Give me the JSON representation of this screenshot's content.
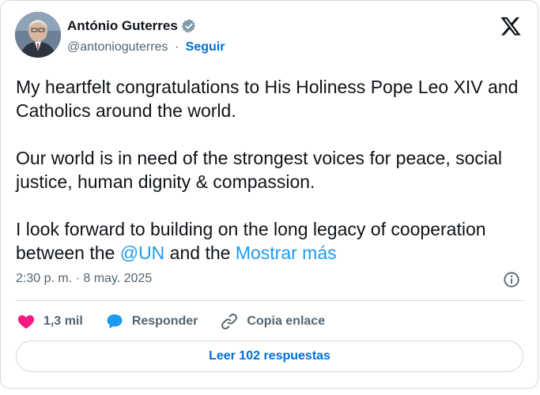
{
  "author": {
    "name": "António Guterres",
    "handle": "@antonioguterres",
    "separator": "·",
    "follow_label": "Seguir"
  },
  "tweet": {
    "para1": "My heartfelt congratulations to His Holiness Pope Leo XIV and Catholics around the world.",
    "para2": "Our world is in need of the strongest voices for peace, social justice, human dignity & compassion.",
    "para3_prefix": "I look forward to building on the long legacy of cooperation between the ",
    "mention": "@UN",
    "para3_mid": " and the ",
    "show_more": "Mostrar más"
  },
  "meta": {
    "timestamp": "2:30 p. m. · 8 may. 2025"
  },
  "actions": {
    "likes": "1,3 mil",
    "reply_label": "Responder",
    "copy_link_label": "Copia enlace"
  },
  "footer": {
    "read_replies_label": "Leer 102 respuestas"
  },
  "colors": {
    "link": "#1d9bf0",
    "like": "#f91880",
    "reply": "#1d9bf0",
    "verified": "#829aab"
  },
  "icons": [
    "verified-badge-icon",
    "x-logo-icon",
    "info-icon",
    "heart-icon",
    "reply-bubble-icon",
    "link-icon"
  ]
}
